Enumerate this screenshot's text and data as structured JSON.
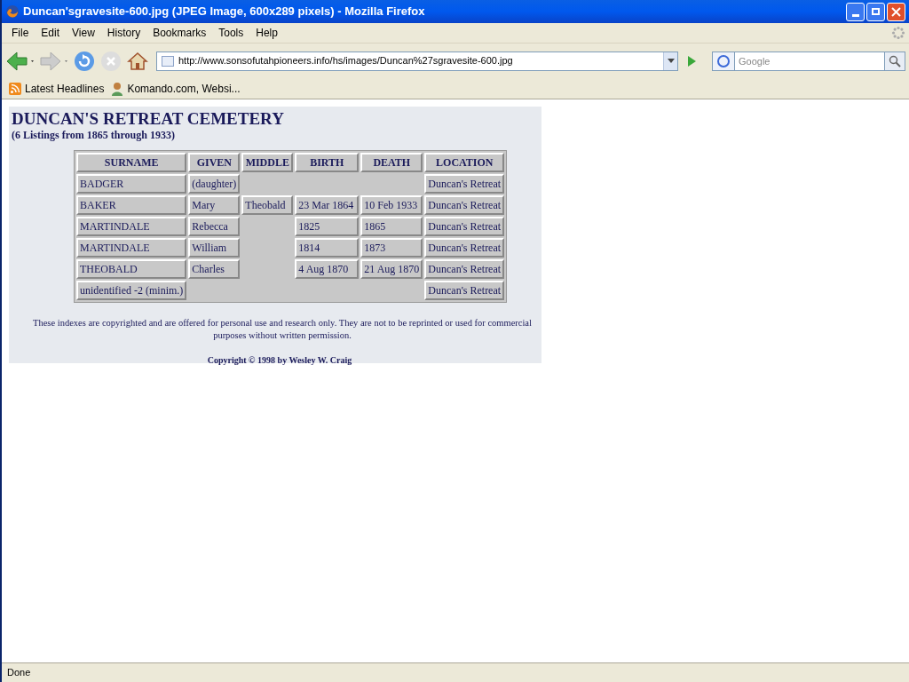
{
  "window": {
    "title": "Duncan'sgravesite-600.jpg (JPEG Image, 600x289 pixels) - Mozilla Firefox"
  },
  "menu": [
    "File",
    "Edit",
    "View",
    "History",
    "Bookmarks",
    "Tools",
    "Help"
  ],
  "address": {
    "url": "http://www.sonsofutahpioneers.info/hs/images/Duncan%27sgravesite-600.jpg"
  },
  "search": {
    "placeholder": "Google"
  },
  "bookmarks": [
    {
      "label": "Latest Headlines",
      "kind": "feed"
    },
    {
      "label": "Komando.com, Websi...",
      "kind": "person"
    }
  ],
  "document": {
    "title": "DUNCAN'S RETREAT CEMETERY",
    "subtitle": "(6 Listings from 1865 through 1933)",
    "table": {
      "columns": [
        "SURNAME",
        "GIVEN",
        "MIDDLE",
        "BIRTH",
        "DEATH",
        "LOCATION"
      ],
      "rows": [
        {
          "surname": "BADGER",
          "given": "(daughter)",
          "location": "Duncan's Retreat"
        },
        {
          "surname": "BAKER",
          "given": "Mary",
          "middle": "Theobald",
          "birth": "23 Mar 1864",
          "death": "10 Feb 1933",
          "location": "Duncan's Retreat"
        },
        {
          "surname": "MARTINDALE",
          "given": "Rebecca",
          "birth": "1825",
          "death": "1865",
          "location": "Duncan's Retreat"
        },
        {
          "surname": "MARTINDALE",
          "given": "William",
          "birth": "1814",
          "death": "1873",
          "location": "Duncan's Retreat"
        },
        {
          "surname": "THEOBALD",
          "given": "Charles",
          "birth": "4 Aug 1870",
          "death": "21 Aug 1870",
          "location": "Duncan's Retreat"
        },
        {
          "surname": "unidentified -2 (minim.)",
          "location": "Duncan's Retreat"
        }
      ]
    },
    "notice": "These indexes are copyrighted and are offered for personal use and research only. They are not to be reprinted or used for commercial purposes without written permission.",
    "copyright": "Copyright © 1998 by Wesley W. Craig"
  },
  "status_bar": {
    "text": "Done"
  }
}
